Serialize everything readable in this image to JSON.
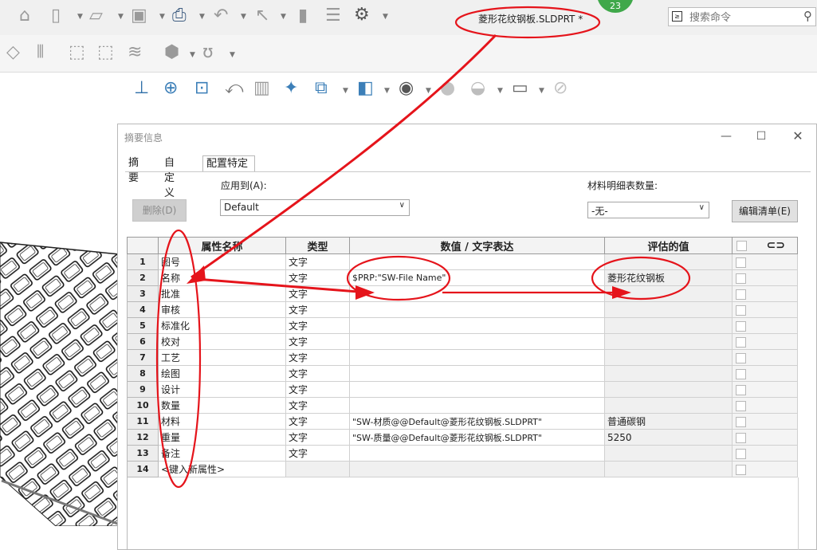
{
  "top_toolbar": {
    "document_title": "菱形花纹钢板.SLDPRT *",
    "badge_count": "23",
    "search_placeholder": "搜索命令",
    "search_prefix": "≥"
  },
  "dialog": {
    "title": "摘要信息",
    "tabs": [
      {
        "label": "摘要"
      },
      {
        "label": "自定义"
      },
      {
        "label": "配置特定",
        "active": true
      }
    ],
    "apply_to_label": "应用到(A):",
    "apply_to_value": "Default",
    "bom_qty_label": "材料明细表数量:",
    "bom_qty_value": "-无-",
    "delete_button": "删除(D)",
    "edit_list_button": "编辑清单(E)",
    "grid": {
      "headers": [
        "属性名称",
        "类型",
        "数值 / 文字表达",
        "评估的值"
      ],
      "rows": [
        {
          "n": "1",
          "name": "图号",
          "type": "文字",
          "expr": "",
          "value": ""
        },
        {
          "n": "2",
          "name": "名称",
          "type": "文字",
          "expr": "$PRP:\"SW-File Name\"",
          "value": "菱形花纹钢板"
        },
        {
          "n": "3",
          "name": "批准",
          "type": "文字",
          "expr": "",
          "value": ""
        },
        {
          "n": "4",
          "name": "审核",
          "type": "文字",
          "expr": "",
          "value": ""
        },
        {
          "n": "5",
          "name": "标准化",
          "type": "文字",
          "expr": "",
          "value": ""
        },
        {
          "n": "6",
          "name": "校对",
          "type": "文字",
          "expr": "",
          "value": ""
        },
        {
          "n": "7",
          "name": "工艺",
          "type": "文字",
          "expr": "",
          "value": ""
        },
        {
          "n": "8",
          "name": "绘图",
          "type": "文字",
          "expr": "",
          "value": ""
        },
        {
          "n": "9",
          "name": "设计",
          "type": "文字",
          "expr": "",
          "value": ""
        },
        {
          "n": "10",
          "name": "数量",
          "type": "文字",
          "expr": "",
          "value": ""
        },
        {
          "n": "11",
          "name": "材料",
          "type": "文字",
          "expr": "\"SW-材质@@Default@菱形花纹钢板.SLDPRT\"",
          "value": "普通碳钢"
        },
        {
          "n": "12",
          "name": "重量",
          "type": "文字",
          "expr": "\"SW-质量@@Default@菱形花纹钢板.SLDPRT\"",
          "value": "5250"
        },
        {
          "n": "13",
          "name": "备注",
          "type": "文字",
          "expr": "",
          "value": ""
        },
        {
          "n": "14",
          "name": "<键入新属性>",
          "type": "",
          "expr": "",
          "value": ""
        }
      ]
    }
  },
  "colors": {
    "annotation": "#e5141b",
    "badge": "#3fa84a"
  }
}
